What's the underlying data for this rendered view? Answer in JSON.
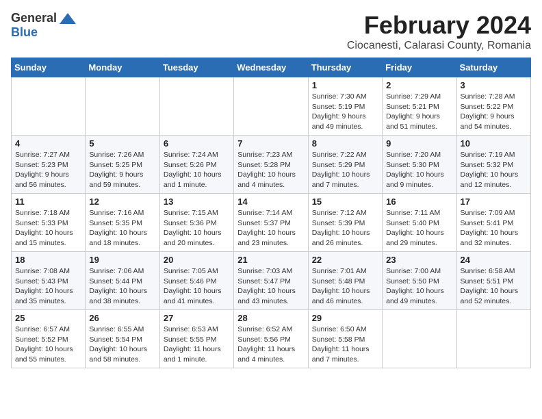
{
  "logo": {
    "general": "General",
    "blue": "Blue"
  },
  "title": "February 2024",
  "subtitle": "Ciocanesti, Calarasi County, Romania",
  "days_of_week": [
    "Sunday",
    "Monday",
    "Tuesday",
    "Wednesday",
    "Thursday",
    "Friday",
    "Saturday"
  ],
  "weeks": [
    [
      {
        "day": "",
        "info": ""
      },
      {
        "day": "",
        "info": ""
      },
      {
        "day": "",
        "info": ""
      },
      {
        "day": "",
        "info": ""
      },
      {
        "day": "1",
        "info": "Sunrise: 7:30 AM\nSunset: 5:19 PM\nDaylight: 9 hours and 49 minutes."
      },
      {
        "day": "2",
        "info": "Sunrise: 7:29 AM\nSunset: 5:21 PM\nDaylight: 9 hours and 51 minutes."
      },
      {
        "day": "3",
        "info": "Sunrise: 7:28 AM\nSunset: 5:22 PM\nDaylight: 9 hours and 54 minutes."
      }
    ],
    [
      {
        "day": "4",
        "info": "Sunrise: 7:27 AM\nSunset: 5:23 PM\nDaylight: 9 hours and 56 minutes."
      },
      {
        "day": "5",
        "info": "Sunrise: 7:26 AM\nSunset: 5:25 PM\nDaylight: 9 hours and 59 minutes."
      },
      {
        "day": "6",
        "info": "Sunrise: 7:24 AM\nSunset: 5:26 PM\nDaylight: 10 hours and 1 minute."
      },
      {
        "day": "7",
        "info": "Sunrise: 7:23 AM\nSunset: 5:28 PM\nDaylight: 10 hours and 4 minutes."
      },
      {
        "day": "8",
        "info": "Sunrise: 7:22 AM\nSunset: 5:29 PM\nDaylight: 10 hours and 7 minutes."
      },
      {
        "day": "9",
        "info": "Sunrise: 7:20 AM\nSunset: 5:30 PM\nDaylight: 10 hours and 9 minutes."
      },
      {
        "day": "10",
        "info": "Sunrise: 7:19 AM\nSunset: 5:32 PM\nDaylight: 10 hours and 12 minutes."
      }
    ],
    [
      {
        "day": "11",
        "info": "Sunrise: 7:18 AM\nSunset: 5:33 PM\nDaylight: 10 hours and 15 minutes."
      },
      {
        "day": "12",
        "info": "Sunrise: 7:16 AM\nSunset: 5:35 PM\nDaylight: 10 hours and 18 minutes."
      },
      {
        "day": "13",
        "info": "Sunrise: 7:15 AM\nSunset: 5:36 PM\nDaylight: 10 hours and 20 minutes."
      },
      {
        "day": "14",
        "info": "Sunrise: 7:14 AM\nSunset: 5:37 PM\nDaylight: 10 hours and 23 minutes."
      },
      {
        "day": "15",
        "info": "Sunrise: 7:12 AM\nSunset: 5:39 PM\nDaylight: 10 hours and 26 minutes."
      },
      {
        "day": "16",
        "info": "Sunrise: 7:11 AM\nSunset: 5:40 PM\nDaylight: 10 hours and 29 minutes."
      },
      {
        "day": "17",
        "info": "Sunrise: 7:09 AM\nSunset: 5:41 PM\nDaylight: 10 hours and 32 minutes."
      }
    ],
    [
      {
        "day": "18",
        "info": "Sunrise: 7:08 AM\nSunset: 5:43 PM\nDaylight: 10 hours and 35 minutes."
      },
      {
        "day": "19",
        "info": "Sunrise: 7:06 AM\nSunset: 5:44 PM\nDaylight: 10 hours and 38 minutes."
      },
      {
        "day": "20",
        "info": "Sunrise: 7:05 AM\nSunset: 5:46 PM\nDaylight: 10 hours and 41 minutes."
      },
      {
        "day": "21",
        "info": "Sunrise: 7:03 AM\nSunset: 5:47 PM\nDaylight: 10 hours and 43 minutes."
      },
      {
        "day": "22",
        "info": "Sunrise: 7:01 AM\nSunset: 5:48 PM\nDaylight: 10 hours and 46 minutes."
      },
      {
        "day": "23",
        "info": "Sunrise: 7:00 AM\nSunset: 5:50 PM\nDaylight: 10 hours and 49 minutes."
      },
      {
        "day": "24",
        "info": "Sunrise: 6:58 AM\nSunset: 5:51 PM\nDaylight: 10 hours and 52 minutes."
      }
    ],
    [
      {
        "day": "25",
        "info": "Sunrise: 6:57 AM\nSunset: 5:52 PM\nDaylight: 10 hours and 55 minutes."
      },
      {
        "day": "26",
        "info": "Sunrise: 6:55 AM\nSunset: 5:54 PM\nDaylight: 10 hours and 58 minutes."
      },
      {
        "day": "27",
        "info": "Sunrise: 6:53 AM\nSunset: 5:55 PM\nDaylight: 11 hours and 1 minute."
      },
      {
        "day": "28",
        "info": "Sunrise: 6:52 AM\nSunset: 5:56 PM\nDaylight: 11 hours and 4 minutes."
      },
      {
        "day": "29",
        "info": "Sunrise: 6:50 AM\nSunset: 5:58 PM\nDaylight: 11 hours and 7 minutes."
      },
      {
        "day": "",
        "info": ""
      },
      {
        "day": "",
        "info": ""
      }
    ]
  ]
}
